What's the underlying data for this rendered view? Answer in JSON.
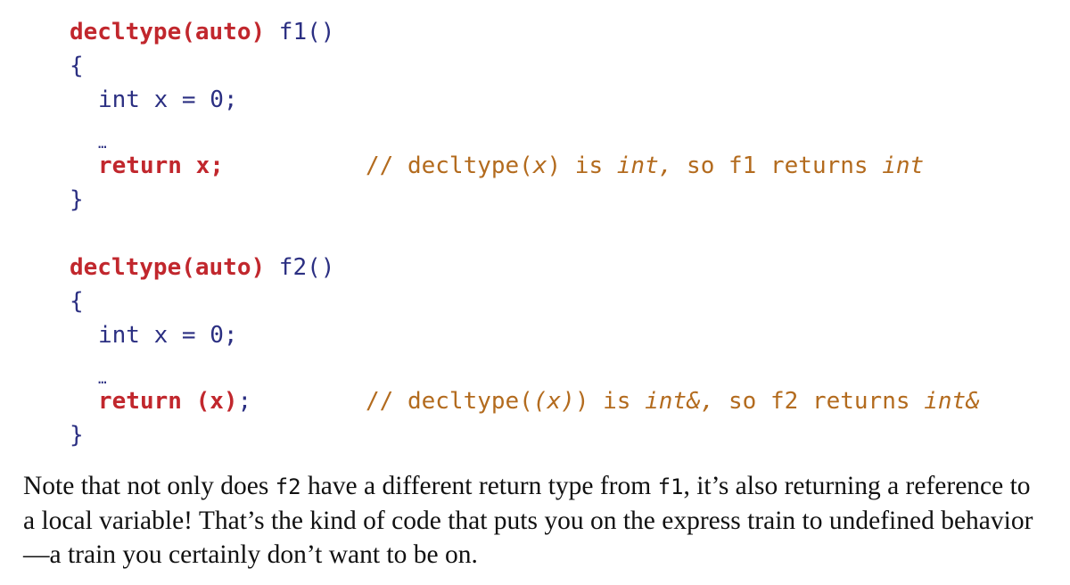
{
  "code_blocks": [
    {
      "decl_keyword": "decltype(auto)",
      "decl_name": " f1()",
      "open_brace": "{",
      "stmt": "int x = 0;",
      "ellipsis": "…",
      "return_text": "return x;",
      "comment_prefix": "// decltype(",
      "comment_arg": "x",
      "comment_mid": ") is ",
      "comment_type1": "int,",
      "comment_tail": " so f1 returns ",
      "comment_type2": "int",
      "close_brace": "}"
    },
    {
      "decl_keyword": "decltype(auto)",
      "decl_name": " f2()",
      "open_brace": "{",
      "stmt": "int x = 0;",
      "ellipsis": "…",
      "return_kw": "return",
      "return_expr": " (x)",
      "return_semi": ";",
      "comment_prefix": "// decltype(",
      "comment_arg": "(x)",
      "comment_mid": ") is ",
      "comment_type1": "int&,",
      "comment_tail": " so f2 returns ",
      "comment_type2": "int&",
      "close_brace": "}"
    }
  ],
  "paragraph": {
    "part1": "Note that not only does ",
    "code1": "f2",
    "part2": " have a different return type from ",
    "code2": "f1",
    "part3": ", it’s also returning a reference to a local variable! That’s the kind of code that puts you on the express train to undefined behavior—a train you certainly don’t want to be on."
  }
}
